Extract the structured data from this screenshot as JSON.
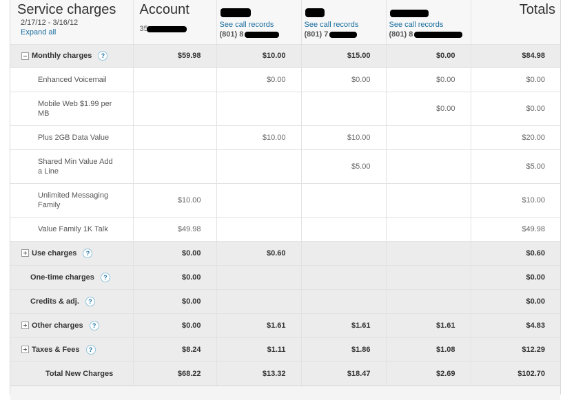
{
  "header": {
    "title": "Service charges",
    "date_range": "2/17/12 - 3/16/12",
    "expand_all": "Expand all",
    "account_title": "Account",
    "account_number_prefix": "35",
    "totals_title": "Totals",
    "lines": [
      {
        "call_records": "See call records",
        "phone": "(801) 8"
      },
      {
        "call_records": "See call records",
        "phone": "(801) 7"
      },
      {
        "call_records": "See call records",
        "phone": "(801) 8"
      }
    ]
  },
  "rows": [
    {
      "type": "section",
      "label": "Monthly charges",
      "toggle": "minus",
      "help": "?",
      "values": [
        "$59.98",
        "$10.00",
        "$15.00",
        "$0.00",
        "$84.98"
      ]
    },
    {
      "type": "detail",
      "label": "Enhanced Voicemail",
      "values": [
        "",
        "$0.00",
        "$0.00",
        "$0.00",
        "$0.00"
      ]
    },
    {
      "type": "detail",
      "label": "Mobile Web $1.99 per MB",
      "values": [
        "",
        "",
        "",
        "$0.00",
        "$0.00"
      ]
    },
    {
      "type": "detail",
      "label": "Plus 2GB Data Value",
      "values": [
        "",
        "$10.00",
        "$10.00",
        "",
        "$20.00"
      ]
    },
    {
      "type": "detail",
      "label": "Shared Min Value Add a Line",
      "values": [
        "",
        "",
        "$5.00",
        "",
        "$5.00"
      ]
    },
    {
      "type": "detail",
      "label": "Unlimited Messaging Family",
      "values": [
        "$10.00",
        "",
        "",
        "",
        "$10.00"
      ]
    },
    {
      "type": "detail",
      "label": "Value Family 1K Talk",
      "values": [
        "$49.98",
        "",
        "",
        "",
        "$49.98"
      ]
    },
    {
      "type": "section",
      "label": "Use charges",
      "toggle": "plus",
      "help": "?",
      "values": [
        "$0.00",
        "$0.60",
        "",
        "",
        "$0.60"
      ]
    },
    {
      "type": "section",
      "label": "One-time charges",
      "toggle": "",
      "help": "?",
      "values": [
        "$0.00",
        "",
        "",
        "",
        "$0.00"
      ]
    },
    {
      "type": "section",
      "label": "Credits & adj.",
      "toggle": "",
      "help": "?",
      "values": [
        "$0.00",
        "",
        "",
        "",
        "$0.00"
      ]
    },
    {
      "type": "section",
      "label": "Other charges",
      "toggle": "plus",
      "help": "?",
      "values": [
        "$0.00",
        "$1.61",
        "$1.61",
        "$1.61",
        "$4.83"
      ]
    },
    {
      "type": "section",
      "label": "Taxes & Fees",
      "toggle": "plus",
      "help": "?",
      "values": [
        "$8.24",
        "$1.11",
        "$1.86",
        "$1.08",
        "$12.29"
      ]
    },
    {
      "type": "total",
      "label": "Total New Charges",
      "values": [
        "$68.22",
        "$13.32",
        "$18.47",
        "$2.69",
        "$102.70"
      ]
    }
  ]
}
